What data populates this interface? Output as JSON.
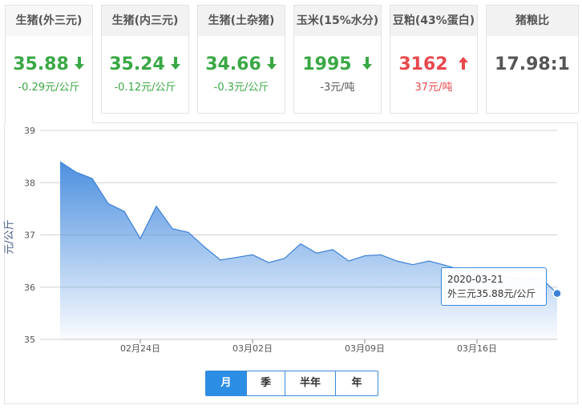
{
  "cards": [
    {
      "title": "生猪(外三元)",
      "price": "35.88",
      "change": "-0.29元/公斤",
      "trend": "down"
    },
    {
      "title": "生猪(内三元)",
      "price": "35.24",
      "change": "-0.12元/公斤",
      "trend": "down"
    },
    {
      "title": "生猪(土杂猪)",
      "price": "34.66",
      "change": "-0.3元/公斤",
      "trend": "down"
    },
    {
      "title": "玉米(15%水分)",
      "price": "1995",
      "change": "-3元/吨",
      "trend": "down"
    },
    {
      "title": "豆粕(43%蛋白)",
      "price": "3162",
      "change": "37元/吨",
      "trend": "up"
    },
    {
      "title": "猪粮比",
      "price": "17.98:1",
      "change": "",
      "trend": "none"
    }
  ],
  "colors": {
    "down": "#3aa845",
    "up": "#e8484d",
    "accent": "#2c8de5",
    "area": "#4d90e0"
  },
  "chart_data": {
    "type": "area",
    "ylabel": "元/公斤",
    "ylim": [
      35,
      39
    ],
    "yticks": [
      "35",
      "36",
      "37",
      "38",
      "39"
    ],
    "xticks": [
      {
        "label": "02月24日",
        "date": "2020-02-24"
      },
      {
        "label": "03月02日",
        "date": "2020-03-02"
      },
      {
        "label": "03月09日",
        "date": "2020-03-09"
      },
      {
        "label": "03月16日",
        "date": "2020-03-16"
      }
    ],
    "grid": true,
    "series": [
      {
        "values": [
          {
            "x": "2020-02-19",
            "y": 38.4
          },
          {
            "x": "2020-02-20",
            "y": 38.2
          },
          {
            "x": "2020-02-21",
            "y": 38.08
          },
          {
            "x": "2020-02-22",
            "y": 37.6
          },
          {
            "x": "2020-02-23",
            "y": 37.45
          },
          {
            "x": "2020-02-24",
            "y": 36.93
          },
          {
            "x": "2020-02-25",
            "y": 37.55
          },
          {
            "x": "2020-02-26",
            "y": 37.12
          },
          {
            "x": "2020-02-27",
            "y": 37.05
          },
          {
            "x": "2020-02-28",
            "y": 36.77
          },
          {
            "x": "2020-02-29",
            "y": 36.52
          },
          {
            "x": "2020-03-01",
            "y": 36.57
          },
          {
            "x": "2020-03-02",
            "y": 36.62
          },
          {
            "x": "2020-03-03",
            "y": 36.47
          },
          {
            "x": "2020-03-04",
            "y": 36.55
          },
          {
            "x": "2020-03-05",
            "y": 36.83
          },
          {
            "x": "2020-03-06",
            "y": 36.65
          },
          {
            "x": "2020-03-07",
            "y": 36.72
          },
          {
            "x": "2020-03-08",
            "y": 36.5
          },
          {
            "x": "2020-03-09",
            "y": 36.6
          },
          {
            "x": "2020-03-10",
            "y": 36.62
          },
          {
            "x": "2020-03-11",
            "y": 36.5
          },
          {
            "x": "2020-03-12",
            "y": 36.43
          },
          {
            "x": "2020-03-13",
            "y": 36.5
          },
          {
            "x": "2020-03-14",
            "y": 36.42
          },
          {
            "x": "2020-03-15",
            "y": 36.33
          },
          {
            "x": "2020-03-16",
            "y": 36.26
          },
          {
            "x": "2020-03-17",
            "y": 36.22
          },
          {
            "x": "2020-03-18",
            "y": 36.19
          },
          {
            "x": "2020-03-19",
            "y": 36.16
          },
          {
            "x": "2020-03-20",
            "y": 36.17
          },
          {
            "x": "2020-03-21",
            "y": 35.88
          }
        ]
      }
    ],
    "highlight": {
      "date": "2020-03-21",
      "text": "外三元35.88元/公斤"
    }
  },
  "tabs": [
    {
      "label": "月",
      "active": true
    },
    {
      "label": "季",
      "active": false
    },
    {
      "label": "半年",
      "active": false
    },
    {
      "label": "年",
      "active": false
    }
  ]
}
